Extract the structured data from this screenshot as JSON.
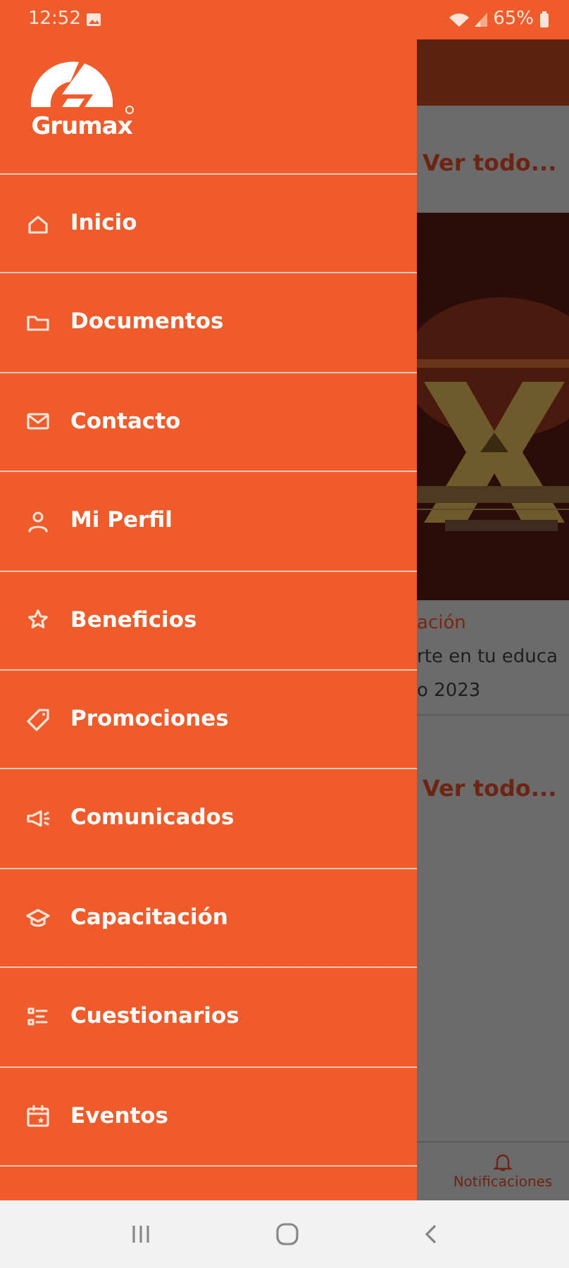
{
  "status_bar": {
    "time": "12:52",
    "battery": "65%"
  },
  "drawer": {
    "logo_text": "Grumax",
    "items": [
      {
        "label": "Inicio"
      },
      {
        "label": "Documentos"
      },
      {
        "label": "Contacto"
      },
      {
        "label": "Mi Perfil"
      },
      {
        "label": "Beneficios"
      },
      {
        "label": "Promociones"
      },
      {
        "label": "Comunicados"
      },
      {
        "label": "Capacitación"
      },
      {
        "label": "Cuestionarios"
      },
      {
        "label": "Eventos"
      }
    ]
  },
  "background": {
    "see_all_1": "Ver todo...",
    "card_category": "ación",
    "card_title": "rte en tu educa",
    "card_date": "o 2023",
    "see_all_2": "Ver todo...",
    "bottom_tab": "Notificaciones"
  }
}
